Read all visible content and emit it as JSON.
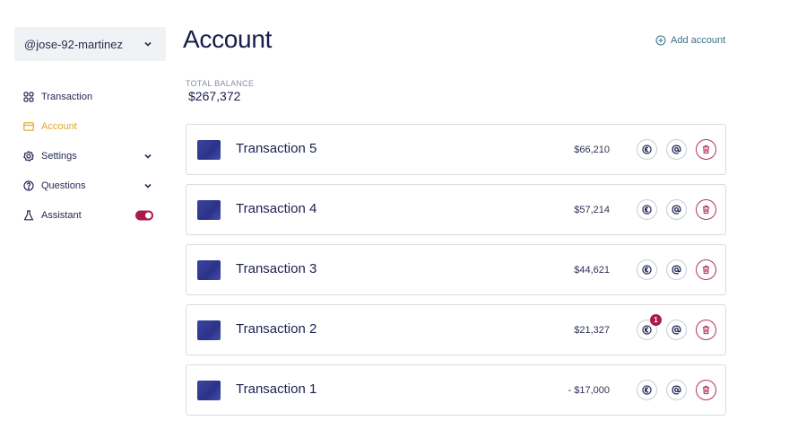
{
  "sidebar": {
    "user": "@jose-92-martinez",
    "items": [
      {
        "label": "Transaction",
        "icon": "grid-icon"
      },
      {
        "label": "Account",
        "icon": "card-icon",
        "active": true
      },
      {
        "label": "Settings",
        "icon": "gear-icon",
        "has_chevron": true
      },
      {
        "label": "Questions",
        "icon": "help-circle-icon",
        "has_chevron": true
      },
      {
        "label": "Assistant",
        "icon": "flask-icon",
        "toggle_on": true
      }
    ]
  },
  "main": {
    "title": "Account",
    "add_account_label": "Add account",
    "total_balance_label": "TOTAL BALANCE",
    "total_balance_value": "$267,372",
    "transactions": [
      {
        "title": "Transaction 5",
        "amount": "$66,210"
      },
      {
        "title": "Transaction 4",
        "amount": "$57,214"
      },
      {
        "title": "Transaction 3",
        "amount": "$44,621"
      },
      {
        "title": "Transaction 2",
        "amount": "$21,327",
        "badge": "1"
      },
      {
        "title": "Transaction 1",
        "amount": "- $17,000"
      }
    ]
  },
  "colors": {
    "accent": "#e4a51e",
    "danger": "#a51e4a",
    "text": "#1b1f4b",
    "thumb": "#333b95"
  }
}
